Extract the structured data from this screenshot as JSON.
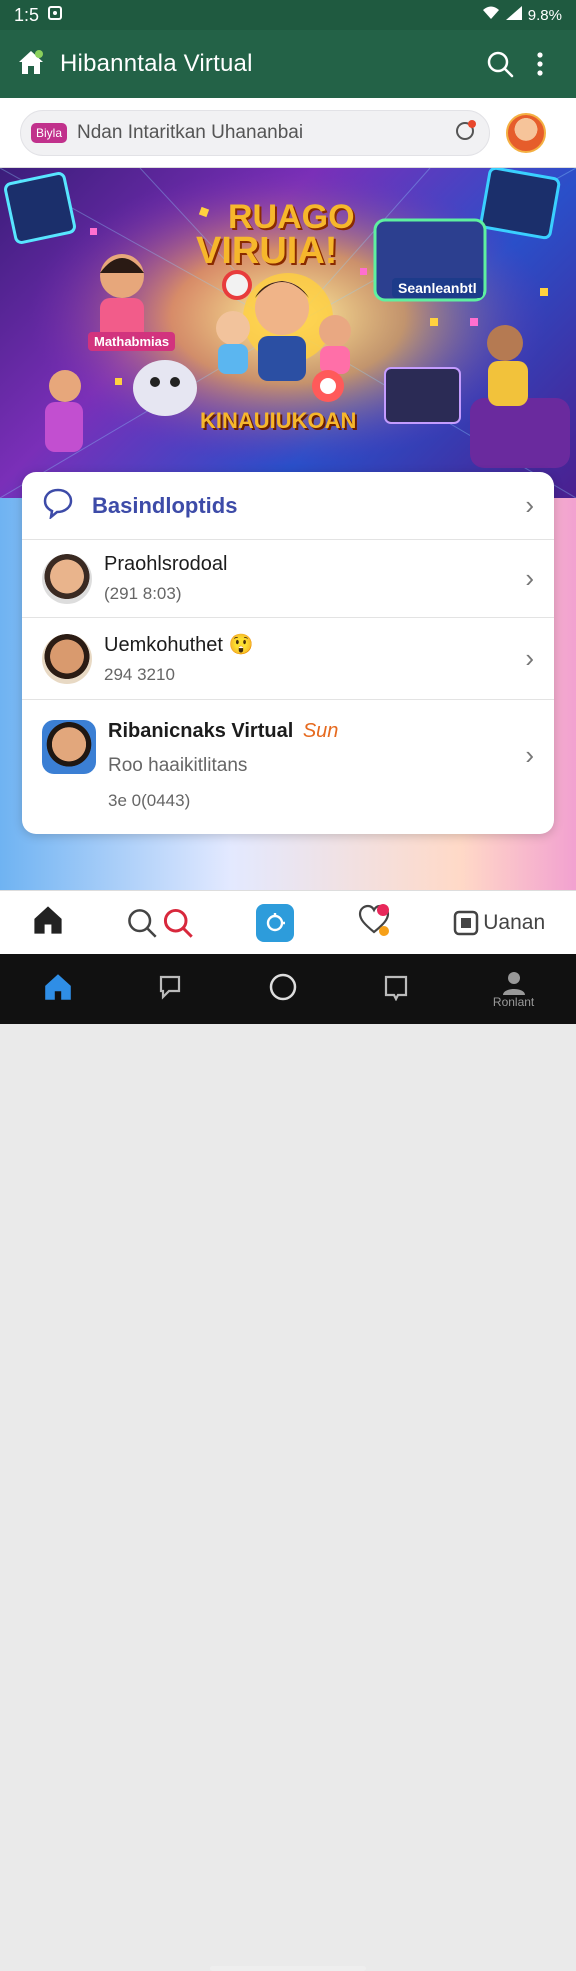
{
  "status": {
    "time": "1:5",
    "battery": "9.8%"
  },
  "appbar": {
    "title": "Hibanntala Virtual"
  },
  "search": {
    "badge": "Biyla",
    "placeholder": "Ndan Intaritkan Uhananbai"
  },
  "banner": {
    "headline_top": "RUAGO",
    "headline_bottom": "VIRUIA!",
    "label_left": "Mathabmias",
    "label_right": "Seanleanbtl",
    "label_bottom": "KINAUIUKOAN"
  },
  "card": {
    "header": {
      "label": "Basindloptids"
    },
    "rows": [
      {
        "name": "Praohlsrodoal",
        "sub": "(291 8:03)",
        "emoji": ""
      },
      {
        "name": "Uemkohuthet",
        "sub": "294 3210",
        "emoji": "😲"
      },
      {
        "name": "Ribanicnaks Virtual",
        "tag": "Sun",
        "sub": "Roo haaikitlitans",
        "sub2": "3e 0(0443)"
      }
    ]
  },
  "tabbar": {
    "last_label": "Uanan"
  },
  "navbar": {
    "profile_label": "Ronlant"
  },
  "colors": {
    "appbar": "#236247",
    "accent": "#2d9cdb",
    "headline": "#f6b72c"
  }
}
